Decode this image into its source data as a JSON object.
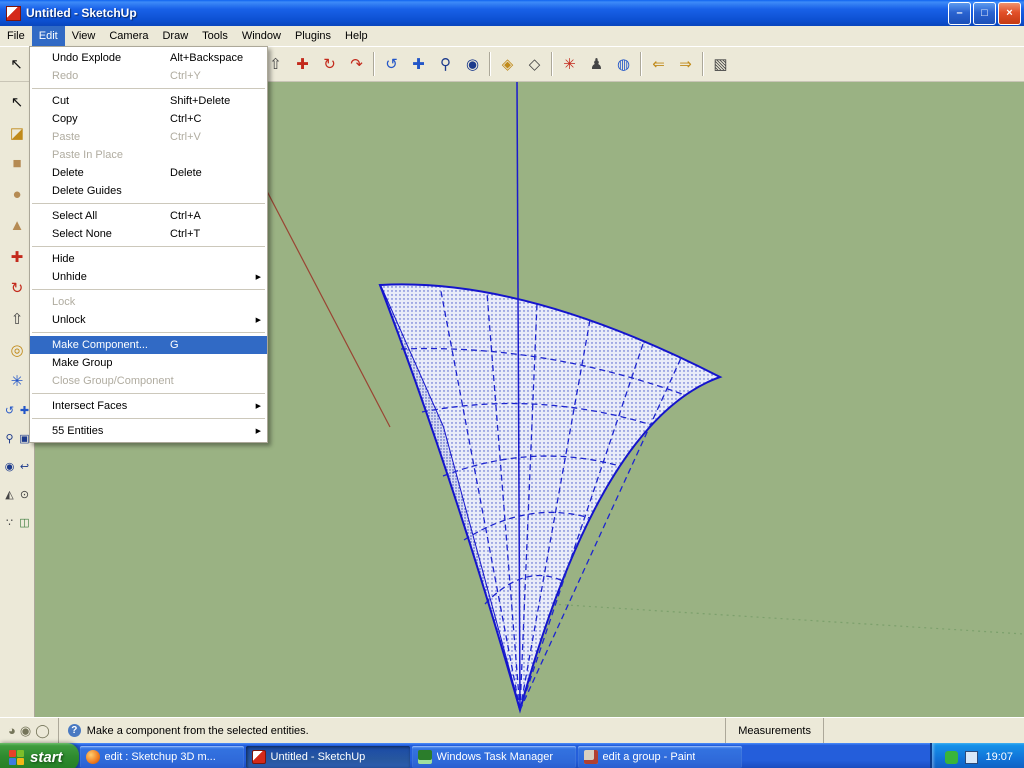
{
  "window": {
    "title": "Untitled - SketchUp",
    "controls": {
      "minimize": "–",
      "maximize": "□",
      "close": "×"
    }
  },
  "menubar": {
    "items": [
      "File",
      "Edit",
      "View",
      "Camera",
      "Draw",
      "Tools",
      "Window",
      "Plugins",
      "Help"
    ],
    "active_item": "Edit"
  },
  "edit_menu": {
    "items": [
      {
        "label": "Undo Explode",
        "shortcut": "Alt+Backspace"
      },
      {
        "label": "Redo",
        "shortcut": "Ctrl+Y",
        "disabled": true
      },
      {
        "label": "Cut",
        "shortcut": "Shift+Delete"
      },
      {
        "label": "Copy",
        "shortcut": "Ctrl+C"
      },
      {
        "label": "Paste",
        "shortcut": "Ctrl+V",
        "disabled": true
      },
      {
        "label": "Paste In Place",
        "shortcut": "",
        "disabled": true
      },
      {
        "label": "Delete",
        "shortcut": "Delete"
      },
      {
        "label": "Delete Guides",
        "shortcut": ""
      },
      {
        "label": "Select All",
        "shortcut": "Ctrl+A"
      },
      {
        "label": "Select None",
        "shortcut": "Ctrl+T"
      },
      {
        "label": "Hide",
        "shortcut": ""
      },
      {
        "label": "Unhide",
        "shortcut": "",
        "submenu": true
      },
      {
        "label": "Lock",
        "shortcut": "",
        "disabled": true
      },
      {
        "label": "Unlock",
        "shortcut": "",
        "submenu": true
      },
      {
        "label": "Make Component...",
        "shortcut": "G",
        "highlighted": true
      },
      {
        "label": "Make Group",
        "shortcut": ""
      },
      {
        "label": "Close Group/Component",
        "shortcut": "",
        "disabled": true
      },
      {
        "label": "Intersect Faces",
        "shortcut": "",
        "submenu": true
      },
      {
        "label": "55 Entities",
        "shortcut": "",
        "submenu": true
      }
    ]
  },
  "toolbar": {
    "icons": [
      {
        "name": "select",
        "glyph": "↖"
      },
      {
        "name": "line",
        "glyph": "✎"
      },
      {
        "name": "rectangle",
        "glyph": "▭"
      },
      {
        "name": "circle",
        "glyph": "●"
      },
      {
        "name": "arc",
        "glyph": "◠"
      },
      {
        "name": "eraser",
        "glyph": "▰"
      },
      {
        "name": "tape-measure",
        "glyph": "⊿"
      },
      {
        "name": "protractor",
        "glyph": "◗"
      },
      {
        "name": "paint-bucket",
        "glyph": "◪"
      },
      {
        "name": "push-pull",
        "glyph": "⇧"
      },
      {
        "name": "move",
        "glyph": "✚"
      },
      {
        "name": "rotate",
        "glyph": "↻"
      },
      {
        "name": "follow-me",
        "glyph": "↷"
      },
      {
        "name": "orbit",
        "glyph": "↺"
      },
      {
        "name": "pan",
        "glyph": "✚"
      },
      {
        "name": "zoom",
        "glyph": "⚲"
      },
      {
        "name": "zoom-extents",
        "glyph": "◉"
      },
      {
        "name": "make-component",
        "glyph": "◈"
      },
      {
        "name": "face-style",
        "glyph": "◇"
      },
      {
        "name": "axes",
        "glyph": "✳"
      },
      {
        "name": "figure",
        "glyph": "♟"
      },
      {
        "name": "globe",
        "glyph": "◍"
      },
      {
        "name": "import",
        "glyph": "⇐"
      },
      {
        "name": "export",
        "glyph": "⇒"
      },
      {
        "name": "box",
        "glyph": "▧"
      }
    ]
  },
  "left_toolbar": {
    "icons": [
      {
        "name": "select",
        "glyph": "↖"
      },
      {
        "name": "paint-bucket",
        "glyph": "◪"
      },
      {
        "name": "rectangle",
        "glyph": "■"
      },
      {
        "name": "circle",
        "glyph": "●"
      },
      {
        "name": "polygon",
        "glyph": "▲"
      },
      {
        "name": "move",
        "glyph": "✚"
      },
      {
        "name": "rotate",
        "glyph": "↻"
      },
      {
        "name": "push-pull",
        "glyph": "⇧"
      },
      {
        "name": "offset",
        "glyph": "◎"
      },
      {
        "name": "axes",
        "glyph": "✳"
      },
      {
        "name": "orbit",
        "glyph": "↺"
      },
      {
        "name": "pan",
        "glyph": "✚"
      },
      {
        "name": "zoom",
        "glyph": "⚲"
      },
      {
        "name": "zoom-window",
        "glyph": "▣"
      },
      {
        "name": "zoom-extents",
        "glyph": "◉"
      },
      {
        "name": "previous-view",
        "glyph": "↩"
      },
      {
        "name": "position-camera",
        "glyph": "◭"
      },
      {
        "name": "look-around",
        "glyph": "⊙"
      },
      {
        "name": "walk",
        "glyph": "∵"
      },
      {
        "name": "section-plane",
        "glyph": "◫"
      }
    ]
  },
  "statusbar": {
    "circle_icons": [
      "◕",
      "◉",
      "◯"
    ],
    "help_glyph": "?",
    "hint": "Make a component from the selected entities.",
    "measurements_label": "Measurements",
    "measurements_value": ""
  },
  "taskbar": {
    "start_label": "start",
    "tasks": [
      {
        "icon": "firefox",
        "label": "edit : Sketchup 3D m..."
      },
      {
        "icon": "sketchup",
        "label": "Untitled - SketchUp",
        "active": true
      },
      {
        "icon": "task-manager",
        "label": "Windows Task Manager"
      },
      {
        "icon": "paint",
        "label": "edit a group - Paint"
      }
    ],
    "clock": "19:07"
  },
  "canvas": {
    "colors": {
      "background": "#9ab283",
      "face_fill": "#e9ecf8",
      "face_stipple": "#4050c8",
      "edges": "#1414cc",
      "axis_blue": "#1a1acd",
      "axis_red": "#994433",
      "axis_green": "#7ca06c",
      "selection_highlight": "#316ac5"
    }
  }
}
